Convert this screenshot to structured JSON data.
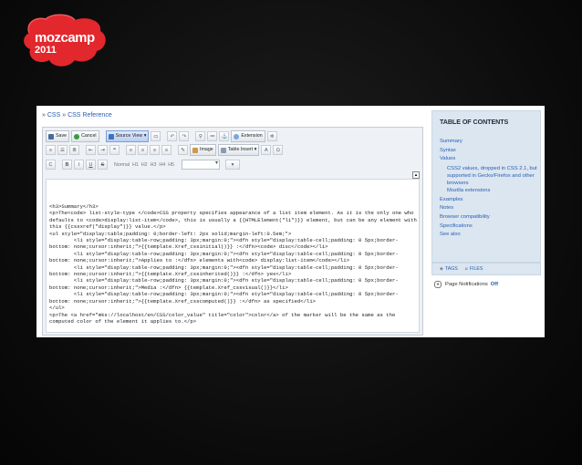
{
  "logo": {
    "line1": "mozcamp",
    "line2": "2011",
    "color": "#e2272d"
  },
  "breadcrumb": {
    "items": [
      "CSS",
      "CSS Reference"
    ],
    "separator": "»"
  },
  "toolbar": {
    "row1": {
      "save_label": "Save",
      "cancel_label": "Cancel",
      "source_label": "Source",
      "view_label": "View",
      "extension_label": "Extension"
    },
    "row2": {
      "image_label": "Image",
      "table_label": "Table",
      "insert_label": "Insert"
    },
    "row3": {
      "normal_label": "Normal",
      "headings": [
        "H1",
        "H2",
        "H3",
        "H4",
        "H5"
      ]
    }
  },
  "code_content": "<h3>Summary</h3>\n<p>The<code> list-style-type </code>CSS property specifies appearance of a list item element. As it is the only one who defaults to <code>display:list-item</code>, this is usually a {{HTMLElement(\"li\")}} element, but can be any element with this {{cssxref(\"display\")}} value.</p>\n<ul style=\"display:table;padding: 0;border-left: 2px solid;margin-left:0.5em;\">\n        <li style=\"display:table-row;padding: 3px;margin:0;\"><dfn style=\"display:table-cell;padding: 0 5px;border-bottom: none;cursor:inherit;\">{{template.Xref_cssinitial()}} :</dfn><code> disc</code></li>\n        <li style=\"display:table-row;padding: 3px;margin:0;\"><dfn style=\"display:table-cell;padding: 0 5px;border-bottom: none;cursor:inherit;\">Applies to :</dfn> elements with<code> display:list-item</code></li>\n        <li style=\"display:table-row;padding: 3px;margin:0;\"><dfn style=\"display:table-cell;padding: 0 5px;border-bottom: none;cursor:inherit;\">{{template.Xref_cssinherited()}} :</dfn> yes</li>\n        <li style=\"display:table-row;padding: 3px;margin:0;\"><dfn style=\"display:table-cell;padding: 0 5px;border-bottom: none;cursor:inherit;\">Media :</dfn> {{template.Xref_cssvisual()}}</li>\n        <li style=\"display:table-row;padding: 3px;margin:0;\"><dfn style=\"display:table-cell;padding: 0 5px;border-bottom: none;cursor:inherit;\">{{template.Xref_csscomputed()}} :</dfn> as specified</li>\n</ul>\n<p>The <a href=\"mks://localhost/en/CSS/color_value\" title=\"color\">color</a> of the marker will be the same as the computed color of the element it applies to.</p>",
  "toc": {
    "title": "TABLE OF CONTENTS",
    "items_top": [
      "Summary",
      "Syntax",
      "Values"
    ],
    "sub_items": [
      "CSS2 values, dropped in CSS 2.1, but supported in Gecko/Firefox and other browsers",
      "Mozilla extensions"
    ],
    "items_bottom": [
      "Examples",
      "Notes",
      "Browser compatibility",
      "Specifications",
      "See also"
    ]
  },
  "tags": {
    "tags_label": "TAGS",
    "files_label": "FILES"
  },
  "notifications": {
    "label": "Page Notifications",
    "state": "Off"
  }
}
